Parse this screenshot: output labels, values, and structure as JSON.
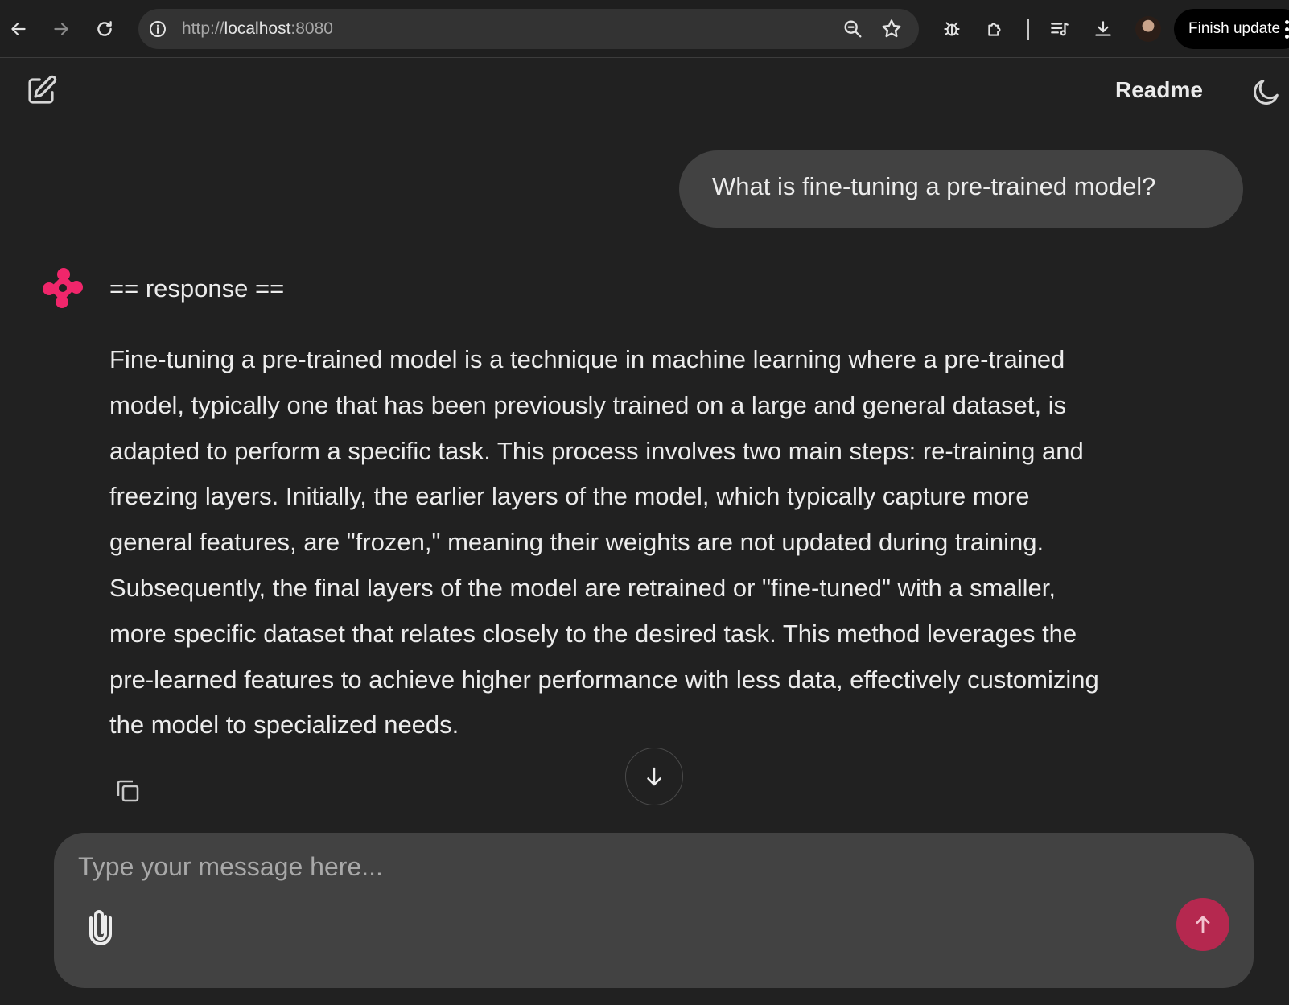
{
  "browser": {
    "url_scheme": "http://",
    "url_host": "localhost",
    "url_port": ":8080",
    "finish_update_label": "Finish update"
  },
  "header": {
    "readme_label": "Readme"
  },
  "conversation": {
    "user_message": "What is fine-tuning a pre-trained model?",
    "assistant_title": "== response ==",
    "assistant_lines": [
      "Fine-tuning a pre-trained model is a technique in machine learning where a pre-trained",
      "model, typically one that has been previously trained on a large and general dataset, is",
      "adapted to perform a specific task. This process involves two main steps: re-training and",
      "freezing layers. Initially, the earlier layers of the model, which typically capture more",
      "general features, are \"frozen,\" meaning their weights are not updated during training.",
      "Subsequently, the final layers of the model are retrained or \"fine-tuned\" with a smaller,",
      "more specific dataset that relates closely to the desired task. This method leverages the",
      "pre-learned features to achieve higher performance with less data, effectively customizing",
      "the model to specialized needs."
    ]
  },
  "composer": {
    "placeholder": "Type your message here...",
    "value": ""
  },
  "colors": {
    "background": "#212121",
    "bubble": "#424242",
    "accent_logo": "#f0266b",
    "send_button": "#b5284f"
  },
  "icons": [
    "back-icon",
    "forward-icon",
    "reload-icon",
    "info-icon",
    "zoom-icon",
    "star-icon",
    "extension-bug-icon",
    "extensions-icon",
    "media-icon",
    "download-icon",
    "new-chat-icon",
    "moon-icon",
    "assistant-logo-icon",
    "copy-icon",
    "arrow-down-icon",
    "paperclip-icon",
    "arrow-up-icon"
  ]
}
